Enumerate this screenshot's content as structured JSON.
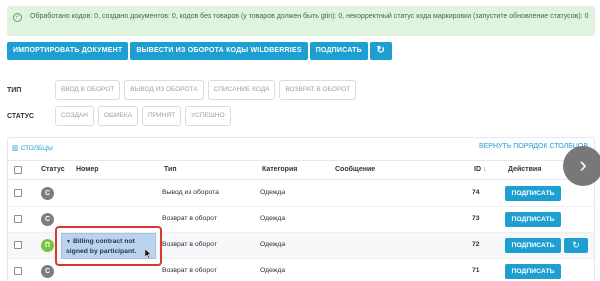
{
  "alert": {
    "icon": "check-circle-icon",
    "text": "Обработано кодов: 0, создано документов: 0, кодов без товаров (у товаров должен быть gtin): 0, некорректный статус кода маркировки (запустите обновление статусов): 0"
  },
  "toolbar": {
    "import_label": "Импортировать документ",
    "withdraw_label": "Вывести из оборота коды Wildberries",
    "sign_label": "Подписать",
    "refresh_icon": "refresh-icon"
  },
  "filters": {
    "type_label": "ТИП",
    "type_options": [
      "Ввод в оборот",
      "Вывод из оборота",
      "Списание кода",
      "Возврат в оборот"
    ],
    "status_label": "СТАТУС",
    "status_options": [
      "Создан",
      "Ошибка",
      "Принят",
      "Успешно"
    ]
  },
  "table": {
    "columns_link": "Столбцы",
    "columns_icon": "columns-icon",
    "reset_order_link": "Вернуть порядок столбцов",
    "headers": {
      "status": "Статус",
      "number": "Номер",
      "type": "Тип",
      "category": "Категория",
      "message": "Сообщение",
      "id": "ID",
      "actions": "Действия"
    },
    "sort_icon": "arrow-down-icon",
    "rows": [
      {
        "status": "С",
        "status_color": "#7a7f85",
        "type": "Вывод из оборота",
        "category": "Одежда",
        "id": "74",
        "sign": "Подписать"
      },
      {
        "status": "С",
        "status_color": "#7a7f85",
        "type": "Возврат в оборот",
        "category": "Одежда",
        "id": "73",
        "sign": "Подписать"
      },
      {
        "status": "П",
        "status_color": "#7cc242",
        "type": "Возврат в оборот",
        "category": "Одежда",
        "id": "72",
        "sign": "Подписать"
      },
      {
        "status": "С",
        "status_color": "#7a7f85",
        "type": "Возврат в оборот",
        "category": "Одежда",
        "id": "71",
        "sign": "Подписать"
      }
    ]
  },
  "tooltip": {
    "text": "Billing contract not signed by participant."
  },
  "colors": {
    "accent": "#1e9fd1",
    "alert_bg": "#dff3e0",
    "highlight_border": "#d63a2f"
  },
  "next_icon": "chevron-right-icon"
}
